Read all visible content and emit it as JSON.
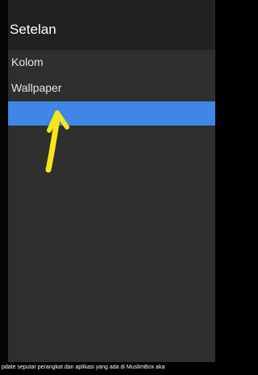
{
  "header": {
    "title": "Setelan"
  },
  "menu": {
    "items": [
      {
        "label": "Kolom"
      },
      {
        "label": "Wallpaper"
      },
      {
        "label": ""
      }
    ]
  },
  "annotation": {
    "arrow_color": "#f6e51a"
  },
  "colors": {
    "header_bg": "#212121",
    "panel_bg": "#2f2f2f",
    "highlight": "#3f86e6"
  },
  "caption": {
    "text": "pdate seputar perangkat dan aplikasi yang ada di MuslimBox aka"
  }
}
